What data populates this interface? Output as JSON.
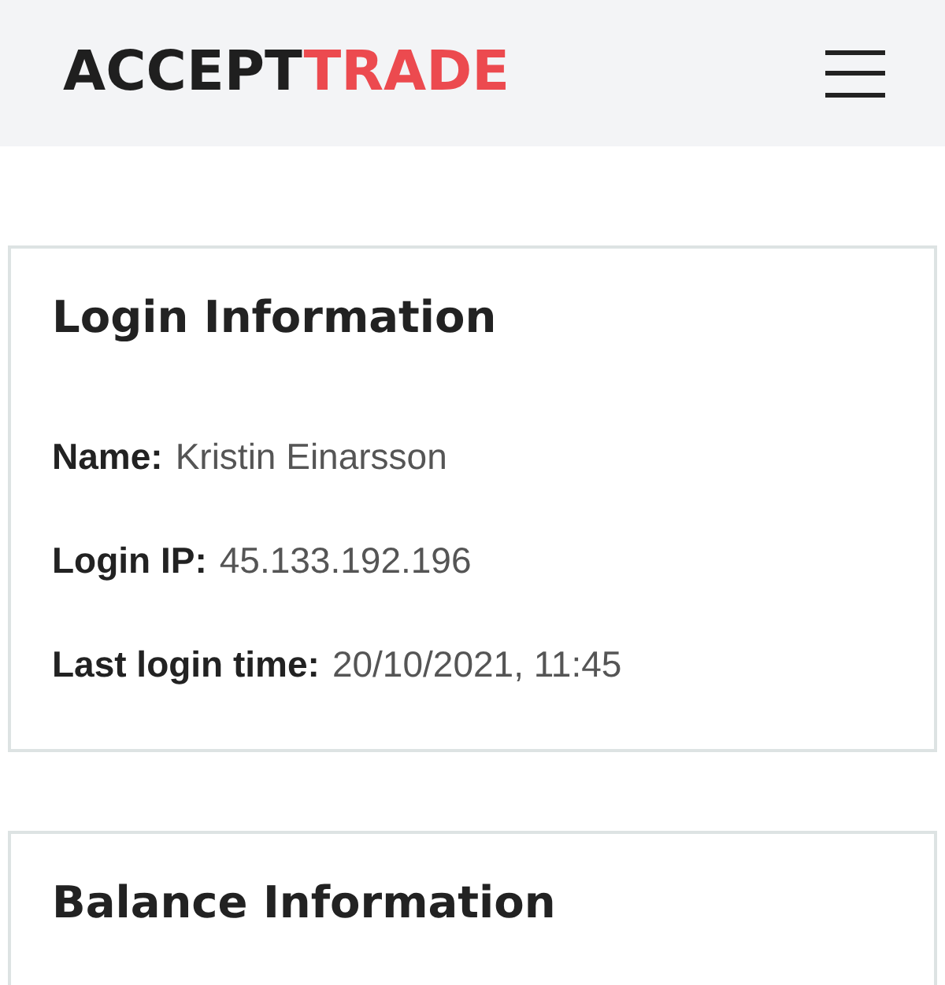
{
  "header": {
    "logo": {
      "primary": "ACCEPT",
      "accent": "TRADE"
    }
  },
  "cards": [
    {
      "title": "Login Information",
      "fields": [
        {
          "label": "Name:",
          "value": "Kristin Einarsson"
        },
        {
          "label": "Login IP:",
          "value": "45.133.192.196"
        },
        {
          "label": "Last login time:",
          "value": "20/10/2021, 11:45"
        }
      ]
    },
    {
      "title": "Balance Information"
    }
  ]
}
